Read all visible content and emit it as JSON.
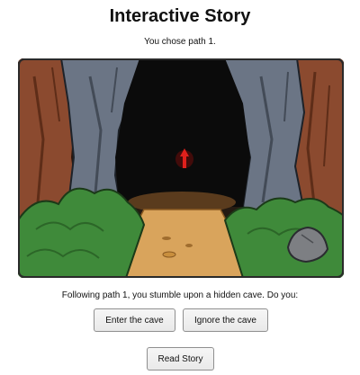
{
  "page": {
    "title": "Interactive Story",
    "status": "You chose path 1."
  },
  "scene": {
    "description_icon": "cave-illustration",
    "colors": {
      "cave_dark": "#0b0b0b",
      "rock": "#6b7585",
      "tree_bark": "#8b4a2f",
      "foliage": "#3f8a3a",
      "path": "#d9a45c",
      "glow_arrow": "#e0201c"
    }
  },
  "story": {
    "text": "Following path 1, you stumble upon a hidden cave. Do you:"
  },
  "choices": [
    {
      "label": "Enter the cave"
    },
    {
      "label": "Ignore the cave"
    }
  ],
  "actions": {
    "read_story_label": "Read Story"
  }
}
